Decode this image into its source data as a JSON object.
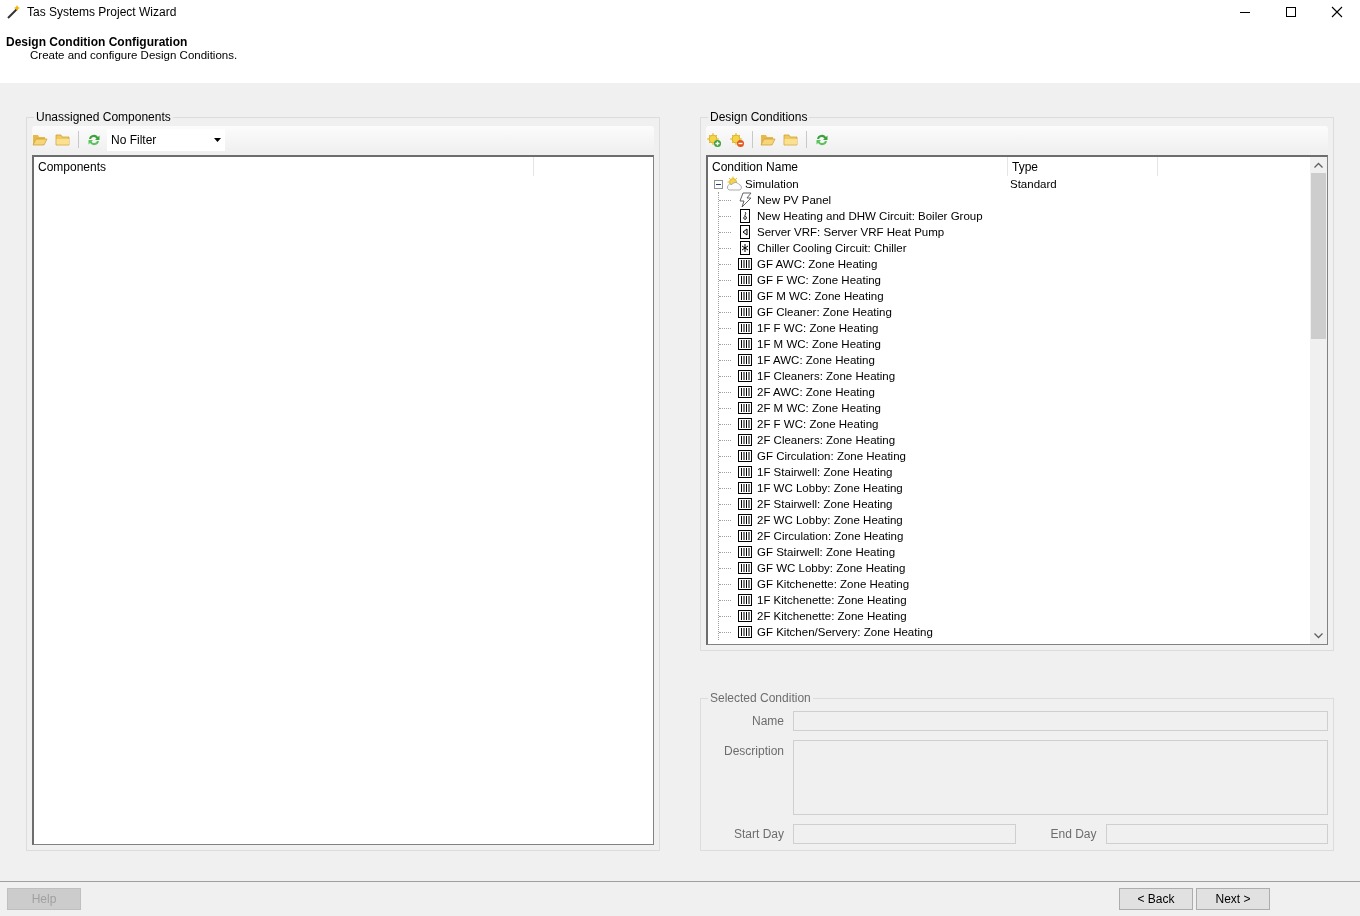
{
  "window": {
    "title": "Tas Systems Project Wizard"
  },
  "header": {
    "title": "Design Condition Configuration",
    "subtitle": "Create and configure Design Conditions."
  },
  "unassigned": {
    "title": "Unassigned Components",
    "filter": "No Filter",
    "columns": [
      "Components"
    ]
  },
  "design_conditions": {
    "title": "Design Conditions",
    "columns": [
      "Condition Name",
      "Type"
    ],
    "tree": [
      {
        "name": "Simulation",
        "type": "Standard",
        "expanded": true,
        "children": [
          {
            "name": "New PV Panel",
            "kind": "pv"
          },
          {
            "name": "New Heating and DHW Circuit: Boiler Group",
            "kind": "boiler"
          },
          {
            "name": "Server VRF: Server VRF Heat Pump",
            "kind": "heatpump"
          },
          {
            "name": "Chiller Cooling Circuit: Chiller",
            "kind": "chiller"
          },
          {
            "name": "GF AWC: Zone Heating",
            "kind": "heating"
          },
          {
            "name": "GF F WC: Zone Heating",
            "kind": "heating"
          },
          {
            "name": "GF M WC: Zone Heating",
            "kind": "heating"
          },
          {
            "name": "GF Cleaner: Zone Heating",
            "kind": "heating"
          },
          {
            "name": "1F F WC: Zone Heating",
            "kind": "heating"
          },
          {
            "name": "1F M WC: Zone Heating",
            "kind": "heating"
          },
          {
            "name": "1F AWC: Zone Heating",
            "kind": "heating"
          },
          {
            "name": "1F Cleaners: Zone Heating",
            "kind": "heating"
          },
          {
            "name": "2F AWC: Zone Heating",
            "kind": "heating"
          },
          {
            "name": "2F M WC: Zone Heating",
            "kind": "heating"
          },
          {
            "name": "2F F WC: Zone Heating",
            "kind": "heating"
          },
          {
            "name": "2F Cleaners: Zone Heating",
            "kind": "heating"
          },
          {
            "name": "GF Circulation: Zone Heating",
            "kind": "heating"
          },
          {
            "name": "1F Stairwell: Zone Heating",
            "kind": "heating"
          },
          {
            "name": "1F WC Lobby: Zone Heating",
            "kind": "heating"
          },
          {
            "name": "2F Stairwell: Zone Heating",
            "kind": "heating"
          },
          {
            "name": "2F WC Lobby: Zone Heating",
            "kind": "heating"
          },
          {
            "name": "2F Circulation: Zone Heating",
            "kind": "heating"
          },
          {
            "name": "GF Stairwell: Zone Heating",
            "kind": "heating"
          },
          {
            "name": "GF WC Lobby: Zone Heating",
            "kind": "heating"
          },
          {
            "name": "GF Kitchenette: Zone Heating",
            "kind": "heating"
          },
          {
            "name": "1F Kitchenette: Zone Heating",
            "kind": "heating"
          },
          {
            "name": "2F Kitchenette: Zone Heating",
            "kind": "heating"
          },
          {
            "name": "GF Kitchen/Servery: Zone Heating",
            "kind": "heating"
          }
        ]
      }
    ]
  },
  "selected_condition": {
    "title": "Selected Condition",
    "disabled": true,
    "name_label": "Name",
    "description_label": "Description",
    "start_day_label": "Start Day",
    "end_day_label": "End Day"
  },
  "buttons": [
    {
      "label": "Help",
      "disabled": true
    },
    {
      "label": "< Back",
      "disabled": false
    },
    {
      "label": "Next >",
      "disabled": false
    }
  ]
}
